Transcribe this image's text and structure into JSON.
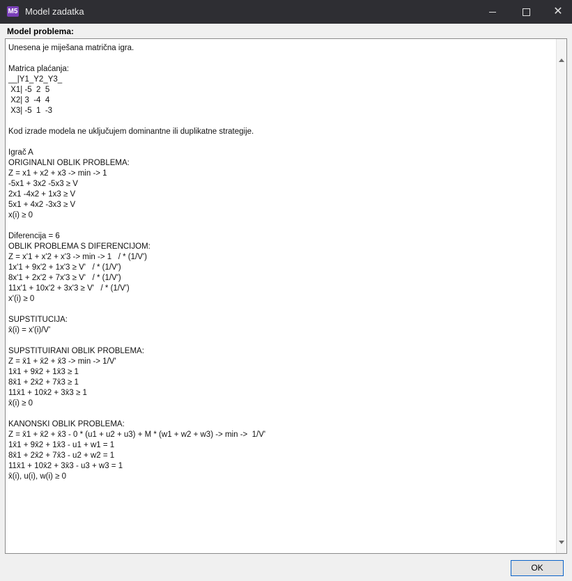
{
  "window": {
    "title": "Model zadatka",
    "app_icon_text": "M5",
    "minimize_glyph": "–",
    "maximize_glyph": "□",
    "close_glyph": "✕"
  },
  "section_label": "Model problema:",
  "problem_text": "Unesena je miješana matrična igra.\n\nMatrica plaćanja:\n__|Y1_Y2_Y3_\n X1| -5  2  5\n X2| 3  -4  4\n X3| -5  1  -3\n\nKod izrade modela ne uključujem dominantne ili duplikatne strategije.\n\nIgrač A\nORIGINALNI OBLIK PROBLEMA:\nZ = x1 + x2 + x3 -> min -> 1\n-5x1 + 3x2 -5x3 ≥ V\n2x1 -4x2 + 1x3 ≥ V\n5x1 + 4x2 -3x3 ≥ V\nx(i) ≥ 0\n\nDiferencija = 6\nOBLIK PROBLEMA S DIFERENCIJOM:\nZ = x'1 + x'2 + x'3 -> min -> 1   / * (1/V')\n1x'1 + 9x'2 + 1x'3 ≥ V'   / * (1/V')\n8x'1 + 2x'2 + 7x'3 ≥ V'   / * (1/V')\n11x'1 + 10x'2 + 3x'3 ≥ V'   / * (1/V')\nx'(i) ≥ 0\n\nSUPSTITUCIJA:\nx̄(i) = x'(i)/V'\n\nSUPSTITUIRANI OBLIK PROBLEMA:\nZ = x̄1 + x̄2 + x̄3 -> min -> 1/V'\n1x̄1 + 9x̄2 + 1x̄3 ≥ 1\n8x̄1 + 2x̄2 + 7x̄3 ≥ 1\n11x̄1 + 10x̄2 + 3x̄3 ≥ 1\nx̄(i) ≥ 0\n\nKANONSKI OBLIK PROBLEMA:\nZ = x̄1 + x̄2 + x̄3 - 0 * (u1 + u2 + u3) + M * (w1 + w2 + w3) -> min ->  1/V'\n1x̄1 + 9x̄2 + 1x̄3 - u1 + w1 = 1\n8x̄1 + 2x̄2 + 7x̄3 - u2 + w2 = 1\n11x̄1 + 10x̄2 + 3x̄3 - u3 + w3 = 1\nx̄(i), u(i), w(i) ≥ 0",
  "ok_button_label": "OK",
  "colors": {
    "titlebar": "#2e2e33",
    "app_icon": "#7a3fb8",
    "ok_border": "#0a63c9"
  }
}
